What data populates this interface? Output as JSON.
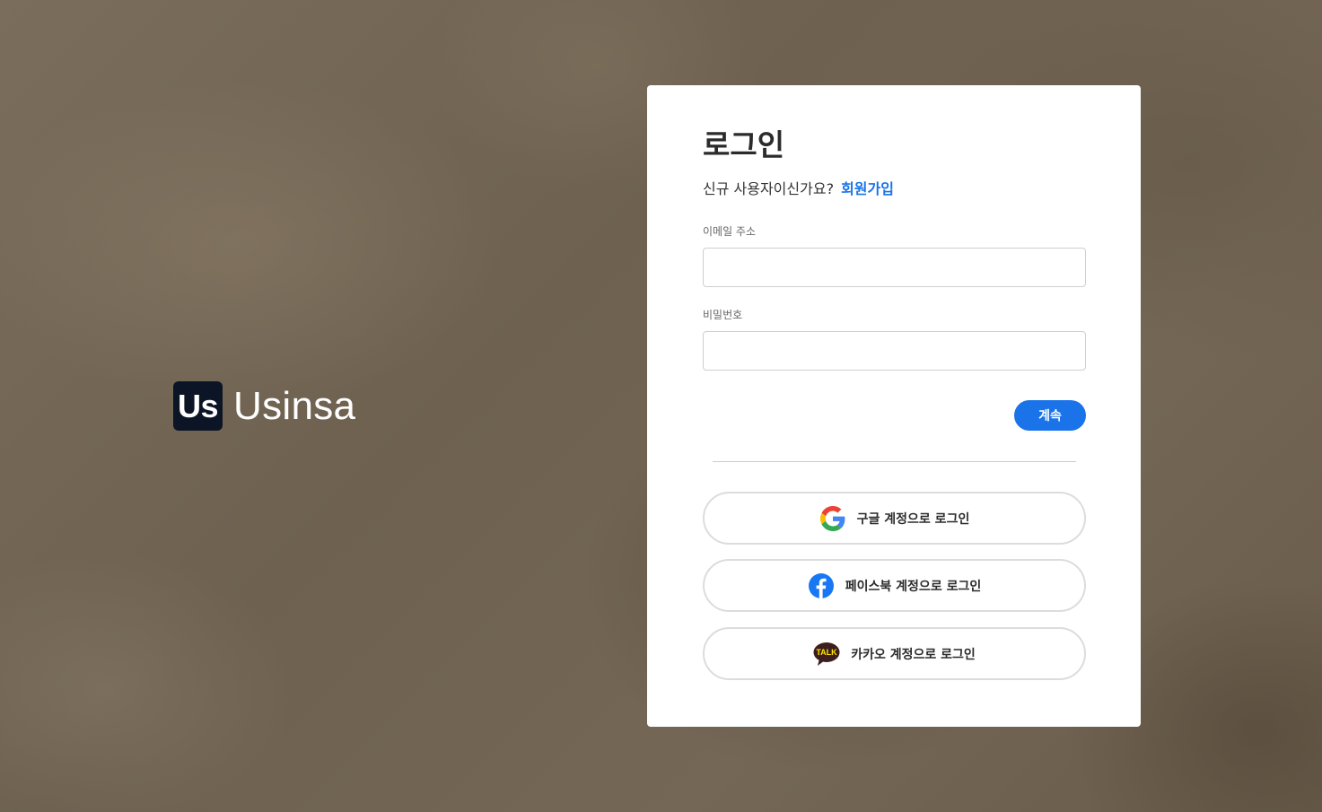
{
  "brand": {
    "mark": "Us",
    "name": "Usinsa"
  },
  "login": {
    "title": "로그인",
    "signup_prompt": "신규 사용자이신가요?",
    "signup_link": "회원가입",
    "email_label": "이메일 주소",
    "email_value": "",
    "password_label": "비밀번호",
    "password_value": "",
    "continue_label": "계속"
  },
  "social": {
    "google_label": "구글 계정으로 로그인",
    "facebook_label": "페이스북 계정으로 로그인",
    "kakao_label": "카카오 계정으로 로그인",
    "kakao_badge": "TALK",
    "google_icon": "google-icon",
    "facebook_icon": "facebook-icon",
    "kakao_icon": "kakao-talk-icon"
  },
  "colors": {
    "accent": "#1a73e8",
    "brand_mark_bg": "#0c1526",
    "facebook": "#1877f2",
    "kakao_bubble": "#3c1e1e",
    "kakao_yellow": "#fee500"
  }
}
